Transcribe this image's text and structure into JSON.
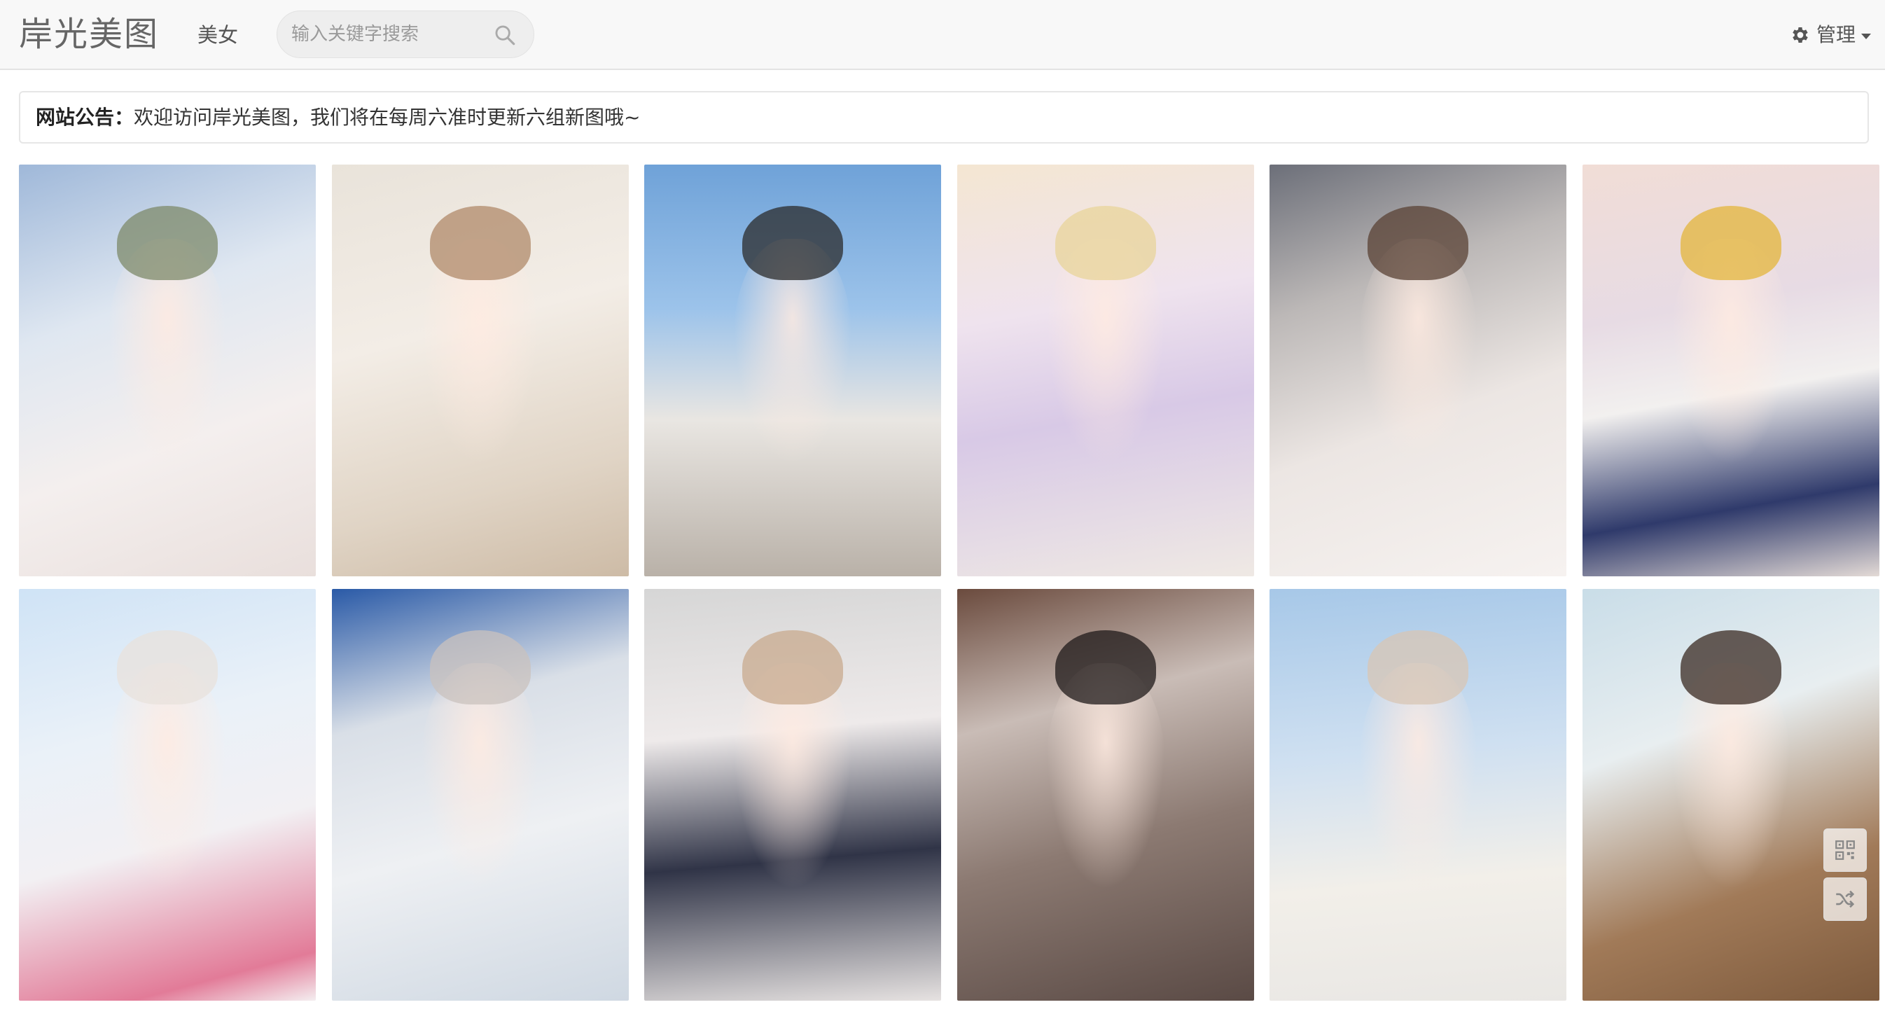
{
  "header": {
    "brand": "岸光美图",
    "nav_link": "美女",
    "search_placeholder": "输入关键字搜索",
    "admin_label": "管理"
  },
  "notice": {
    "label": "网站公告：",
    "text": "欢迎访问岸光美图，我们将在每周六准时更新六组新图哦~"
  },
  "gallery": {
    "rows": 2,
    "columns": 6,
    "items": [
      {
        "row": 1,
        "col": 1
      },
      {
        "row": 1,
        "col": 2
      },
      {
        "row": 1,
        "col": 3
      },
      {
        "row": 1,
        "col": 4
      },
      {
        "row": 1,
        "col": 5
      },
      {
        "row": 1,
        "col": 6
      },
      {
        "row": 2,
        "col": 1
      },
      {
        "row": 2,
        "col": 2
      },
      {
        "row": 2,
        "col": 3
      },
      {
        "row": 2,
        "col": 4
      },
      {
        "row": 2,
        "col": 5
      },
      {
        "row": 2,
        "col": 6
      }
    ]
  },
  "floating_buttons": [
    {
      "icon": "qr-code-icon"
    },
    {
      "icon": "shuffle-icon"
    }
  ],
  "colors": {
    "navbar_bg": "#f8f8f8",
    "search_bg": "#eeeeee",
    "text": "#333333"
  }
}
